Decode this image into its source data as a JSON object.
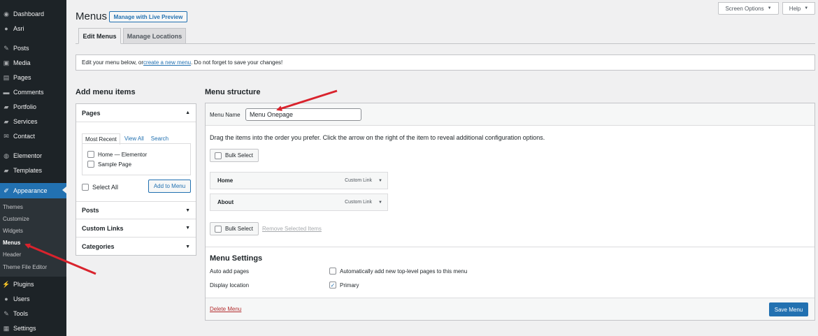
{
  "sidebar": {
    "items": [
      {
        "label": "Dashboard",
        "icon": "dashboard-icon",
        "glyph": "◉"
      },
      {
        "label": "Asri",
        "icon": "site-icon",
        "glyph": "●"
      },
      {
        "label": "Posts",
        "icon": "pin-icon",
        "glyph": "✎"
      },
      {
        "label": "Media",
        "icon": "media-icon",
        "glyph": "▣"
      },
      {
        "label": "Pages",
        "icon": "pages-icon",
        "glyph": "▤"
      },
      {
        "label": "Comments",
        "icon": "comments-icon",
        "glyph": "▬"
      },
      {
        "label": "Portfolio",
        "icon": "folder-icon",
        "glyph": "▰"
      },
      {
        "label": "Services",
        "icon": "services-icon",
        "glyph": "▰"
      },
      {
        "label": "Contact",
        "icon": "mail-icon",
        "glyph": "✉"
      },
      {
        "label": "Elementor",
        "icon": "elementor-icon",
        "glyph": "◍"
      },
      {
        "label": "Templates",
        "icon": "folder-icon",
        "glyph": "▰"
      },
      {
        "label": "Appearance",
        "icon": "brush-icon",
        "glyph": "✐"
      },
      {
        "label": "Plugins",
        "icon": "plugin-icon",
        "glyph": "⚡"
      },
      {
        "label": "Users",
        "icon": "users-icon",
        "glyph": "●"
      },
      {
        "label": "Tools",
        "icon": "wrench-icon",
        "glyph": "✎"
      },
      {
        "label": "Settings",
        "icon": "settings-icon",
        "glyph": "▦"
      }
    ],
    "submenu": [
      "Themes",
      "Customize",
      "Widgets",
      "Menus",
      "Header",
      "Theme File Editor"
    ]
  },
  "header": {
    "title": "Menus",
    "live_preview": "Manage with Live Preview",
    "screen_options": "Screen Options",
    "help": "Help"
  },
  "tabs": {
    "edit": "Edit Menus",
    "locations": "Manage Locations"
  },
  "notice": {
    "before": "Edit your menu below, or ",
    "link": "create a new menu",
    "after": ". Do not forget to save your changes!"
  },
  "add_items": {
    "heading": "Add menu items",
    "pages_section": "Pages",
    "tabs": [
      "Most Recent",
      "View All",
      "Search"
    ],
    "pages": [
      "Home — Elementor",
      "Sample Page"
    ],
    "select_all": "Select All",
    "add_button": "Add to Menu",
    "sections": [
      "Posts",
      "Custom Links",
      "Categories"
    ]
  },
  "structure": {
    "heading": "Menu structure",
    "name_label": "Menu Name",
    "name_value": "Menu Onepage",
    "instructions": "Drag the items into the order you prefer. Click the arrow on the right of the item to reveal additional configuration options.",
    "bulk_select": "Bulk Select",
    "remove_selected": "Remove Selected Items",
    "items": [
      {
        "label": "Home",
        "type": "Custom Link"
      },
      {
        "label": "About",
        "type": "Custom Link"
      }
    ],
    "settings_heading": "Menu Settings",
    "auto_add_label": "Auto add pages",
    "auto_add_text": "Automatically add new top-level pages to this menu",
    "display_label": "Display location",
    "primary_text": "Primary",
    "delete_menu": "Delete Menu",
    "save_menu": "Save Menu"
  },
  "colors": {
    "sidebar_bg": "#1d2327",
    "accent": "#2271b1",
    "annotation_arrow": "#d9232d"
  }
}
